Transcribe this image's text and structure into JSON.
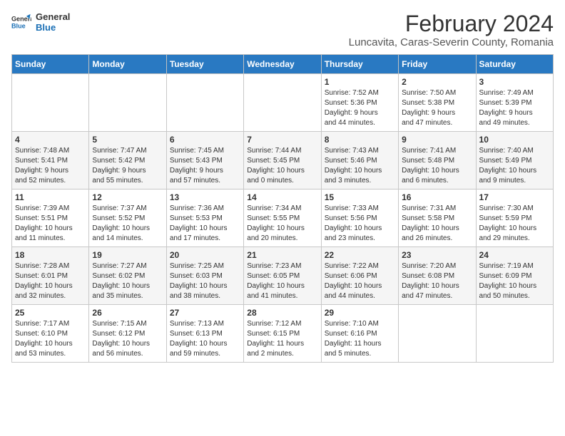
{
  "header": {
    "logo_line1": "General",
    "logo_line2": "Blue",
    "month_year": "February 2024",
    "location": "Luncavita, Caras-Severin County, Romania"
  },
  "days_of_week": [
    "Sunday",
    "Monday",
    "Tuesday",
    "Wednesday",
    "Thursday",
    "Friday",
    "Saturday"
  ],
  "weeks": [
    [
      {
        "day": "",
        "info": ""
      },
      {
        "day": "",
        "info": ""
      },
      {
        "day": "",
        "info": ""
      },
      {
        "day": "",
        "info": ""
      },
      {
        "day": "1",
        "info": "Sunrise: 7:52 AM\nSunset: 5:36 PM\nDaylight: 9 hours\nand 44 minutes."
      },
      {
        "day": "2",
        "info": "Sunrise: 7:50 AM\nSunset: 5:38 PM\nDaylight: 9 hours\nand 47 minutes."
      },
      {
        "day": "3",
        "info": "Sunrise: 7:49 AM\nSunset: 5:39 PM\nDaylight: 9 hours\nand 49 minutes."
      }
    ],
    [
      {
        "day": "4",
        "info": "Sunrise: 7:48 AM\nSunset: 5:41 PM\nDaylight: 9 hours\nand 52 minutes."
      },
      {
        "day": "5",
        "info": "Sunrise: 7:47 AM\nSunset: 5:42 PM\nDaylight: 9 hours\nand 55 minutes."
      },
      {
        "day": "6",
        "info": "Sunrise: 7:45 AM\nSunset: 5:43 PM\nDaylight: 9 hours\nand 57 minutes."
      },
      {
        "day": "7",
        "info": "Sunrise: 7:44 AM\nSunset: 5:45 PM\nDaylight: 10 hours\nand 0 minutes."
      },
      {
        "day": "8",
        "info": "Sunrise: 7:43 AM\nSunset: 5:46 PM\nDaylight: 10 hours\nand 3 minutes."
      },
      {
        "day": "9",
        "info": "Sunrise: 7:41 AM\nSunset: 5:48 PM\nDaylight: 10 hours\nand 6 minutes."
      },
      {
        "day": "10",
        "info": "Sunrise: 7:40 AM\nSunset: 5:49 PM\nDaylight: 10 hours\nand 9 minutes."
      }
    ],
    [
      {
        "day": "11",
        "info": "Sunrise: 7:39 AM\nSunset: 5:51 PM\nDaylight: 10 hours\nand 11 minutes."
      },
      {
        "day": "12",
        "info": "Sunrise: 7:37 AM\nSunset: 5:52 PM\nDaylight: 10 hours\nand 14 minutes."
      },
      {
        "day": "13",
        "info": "Sunrise: 7:36 AM\nSunset: 5:53 PM\nDaylight: 10 hours\nand 17 minutes."
      },
      {
        "day": "14",
        "info": "Sunrise: 7:34 AM\nSunset: 5:55 PM\nDaylight: 10 hours\nand 20 minutes."
      },
      {
        "day": "15",
        "info": "Sunrise: 7:33 AM\nSunset: 5:56 PM\nDaylight: 10 hours\nand 23 minutes."
      },
      {
        "day": "16",
        "info": "Sunrise: 7:31 AM\nSunset: 5:58 PM\nDaylight: 10 hours\nand 26 minutes."
      },
      {
        "day": "17",
        "info": "Sunrise: 7:30 AM\nSunset: 5:59 PM\nDaylight: 10 hours\nand 29 minutes."
      }
    ],
    [
      {
        "day": "18",
        "info": "Sunrise: 7:28 AM\nSunset: 6:01 PM\nDaylight: 10 hours\nand 32 minutes."
      },
      {
        "day": "19",
        "info": "Sunrise: 7:27 AM\nSunset: 6:02 PM\nDaylight: 10 hours\nand 35 minutes."
      },
      {
        "day": "20",
        "info": "Sunrise: 7:25 AM\nSunset: 6:03 PM\nDaylight: 10 hours\nand 38 minutes."
      },
      {
        "day": "21",
        "info": "Sunrise: 7:23 AM\nSunset: 6:05 PM\nDaylight: 10 hours\nand 41 minutes."
      },
      {
        "day": "22",
        "info": "Sunrise: 7:22 AM\nSunset: 6:06 PM\nDaylight: 10 hours\nand 44 minutes."
      },
      {
        "day": "23",
        "info": "Sunrise: 7:20 AM\nSunset: 6:08 PM\nDaylight: 10 hours\nand 47 minutes."
      },
      {
        "day": "24",
        "info": "Sunrise: 7:19 AM\nSunset: 6:09 PM\nDaylight: 10 hours\nand 50 minutes."
      }
    ],
    [
      {
        "day": "25",
        "info": "Sunrise: 7:17 AM\nSunset: 6:10 PM\nDaylight: 10 hours\nand 53 minutes."
      },
      {
        "day": "26",
        "info": "Sunrise: 7:15 AM\nSunset: 6:12 PM\nDaylight: 10 hours\nand 56 minutes."
      },
      {
        "day": "27",
        "info": "Sunrise: 7:13 AM\nSunset: 6:13 PM\nDaylight: 10 hours\nand 59 minutes."
      },
      {
        "day": "28",
        "info": "Sunrise: 7:12 AM\nSunset: 6:15 PM\nDaylight: 11 hours\nand 2 minutes."
      },
      {
        "day": "29",
        "info": "Sunrise: 7:10 AM\nSunset: 6:16 PM\nDaylight: 11 hours\nand 5 minutes."
      },
      {
        "day": "",
        "info": ""
      },
      {
        "day": "",
        "info": ""
      }
    ]
  ]
}
